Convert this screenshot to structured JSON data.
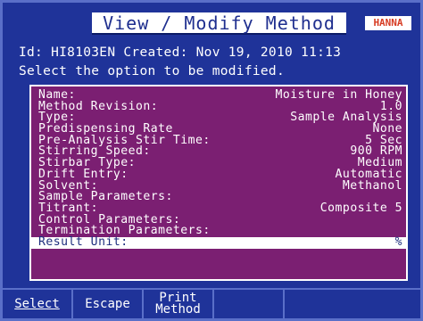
{
  "header": {
    "title": "View / Modify Method",
    "brand": "HANNA"
  },
  "info": {
    "line1": "Id: HI8103EN  Created: Nov 19, 2010 11:13",
    "line2": "Select the option to be modified."
  },
  "options": [
    {
      "label": "Name:",
      "value": "Moisture in Honey"
    },
    {
      "label": "Method Revision:",
      "value": "1.0"
    },
    {
      "label": "Type:",
      "value": "Sample Analysis"
    },
    {
      "label": "Predispensing Rate",
      "value": "None"
    },
    {
      "label": "Pre-Analysis Stir Time:",
      "value": "5 Sec"
    },
    {
      "label": "Stirring Speed:",
      "value": "900 RPM"
    },
    {
      "label": "Stirbar Type:",
      "value": "Medium"
    },
    {
      "label": "Drift Entry:",
      "value": "Automatic"
    },
    {
      "label": "Solvent:",
      "value": "Methanol"
    },
    {
      "label": "Sample Parameters:",
      "value": ""
    },
    {
      "label": "Titrant:",
      "value": "Composite 5"
    },
    {
      "label": "Control Parameters:",
      "value": ""
    },
    {
      "label": "Termination Parameters:",
      "value": ""
    },
    {
      "label": "Result Unit:",
      "value": "%"
    }
  ],
  "footer": {
    "select": "Select",
    "escape": "Escape",
    "print_line1": "Print",
    "print_line2": "Method",
    "empty1": "",
    "empty2": ""
  }
}
